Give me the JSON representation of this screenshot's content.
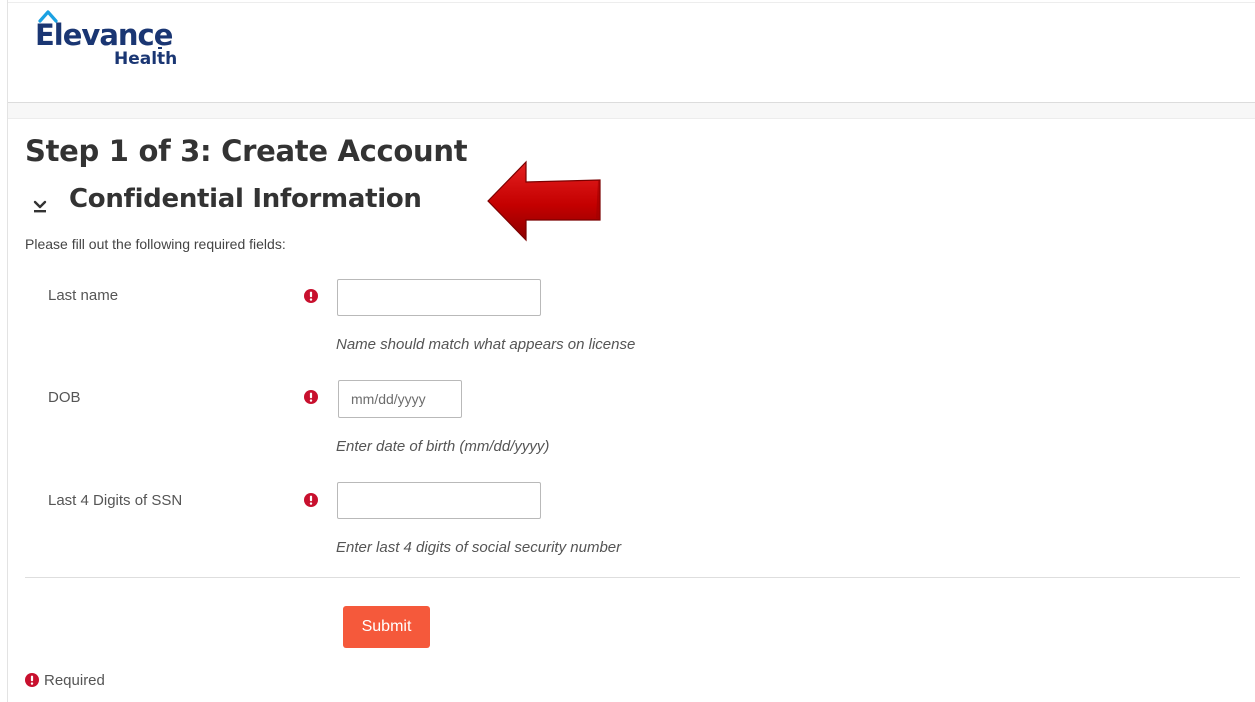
{
  "brand": {
    "logo_word": "Elevance",
    "logo_sub": "Health",
    "color": "#1a3673"
  },
  "page": {
    "step_title": "Step 1 of 3: Create Account",
    "section_title": "Confidential Information",
    "instructions": "Please fill out the following required fields:"
  },
  "form": {
    "fields": [
      {
        "label": "Last name",
        "value": "",
        "placeholder": "",
        "help": "Name should match what appears on license",
        "required": true
      },
      {
        "label": "DOB",
        "value": "",
        "placeholder": "mm/dd/yyyy",
        "help": "Enter date of birth (mm/dd/yyyy)",
        "required": true
      },
      {
        "label": "Last 4 Digits of SSN",
        "value": "",
        "placeholder": "",
        "help": "Enter last 4 digits of social security number",
        "required": true
      }
    ],
    "submit_label": "Submit",
    "required_legend": "Required"
  },
  "colors": {
    "required_icon": "#c8102e",
    "submit_button": "#f5593b",
    "annotation_arrow": "#c40000"
  },
  "icons": {
    "required": "exclamation-circle-icon",
    "collapse": "chevron-down-icon",
    "annotation": "arrow-left-icon"
  }
}
